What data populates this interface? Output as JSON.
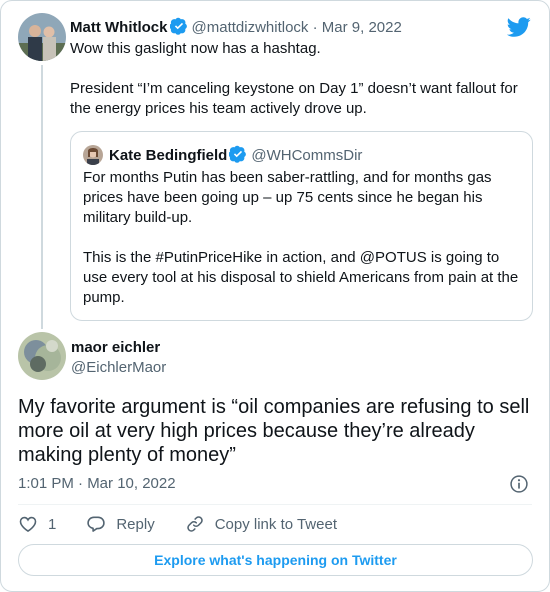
{
  "parent_tweet": {
    "name": "Matt Whitlock",
    "handle": "@mattdizwhitlock",
    "separator": "·",
    "date": "Mar 9, 2022",
    "paragraphs": [
      "Wow this gaslight now has a hashtag.",
      "President “I’m canceling keystone on Day 1” doesn’t want fallout for the energy prices his team actively drove up."
    ]
  },
  "quoted_tweet": {
    "name": "Kate Bedingfield",
    "handle": "@WHCommsDir",
    "paragraphs": [
      "For months Putin has been saber-rattling, and for months gas prices have been going up – up 75 cents since he began his military build-up.",
      "This is the #PutinPriceHike in action, and @POTUS is going to use every tool at his disposal to shield Americans from pain at the pump."
    ]
  },
  "main_tweet": {
    "name": "maor eichler",
    "handle": "@EichlerMaor",
    "text": "My favorite argument is “oil companies are refusing to sell more oil at very high prices because they’re already making plenty of money”",
    "timestamp": "1:01 PM · Mar 10, 2022"
  },
  "actions": {
    "like_count": "1",
    "reply_label": "Reply",
    "copy_link_label": "Copy link to Tweet"
  },
  "explore_label": "Explore what's happening on Twitter",
  "colors": {
    "accent": "#1d9bf0",
    "verified": "#1d9bf0",
    "text": "#0f1419",
    "muted": "#536471",
    "border": "#cfd9de"
  },
  "icons": [
    "twitter-logo-icon",
    "verified-badge-icon",
    "info-icon",
    "heart-icon",
    "reply-icon",
    "link-icon"
  ]
}
